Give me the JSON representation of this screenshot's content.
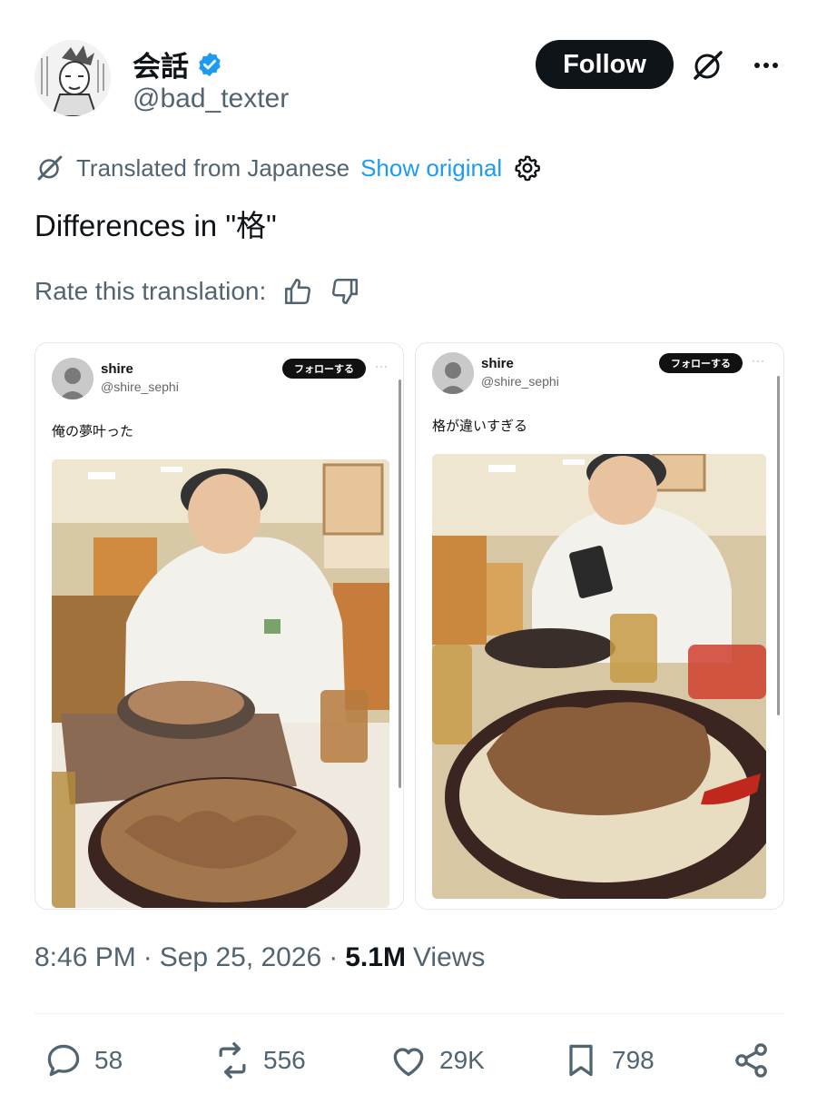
{
  "author": {
    "display_name": "会話",
    "handle": "@bad_texter",
    "verified": true,
    "follow_label": "Follow"
  },
  "translation": {
    "notice": "Translated from Japanese",
    "show_original": "Show original",
    "rate_label": "Rate this translation:"
  },
  "tweet": {
    "text": "Differences in \"格\""
  },
  "media": [
    {
      "name": "shire",
      "handle": "@shire_sephi",
      "follow_label": "フォローする",
      "text": "俺の夢叶った"
    },
    {
      "name": "shire",
      "handle": "@shire_sephi",
      "follow_label": "フォローする",
      "text": "格が違いすぎる"
    }
  ],
  "meta": {
    "time": "8:46 PM",
    "separator": "·",
    "date": "Sep 25, 2026",
    "views_count": "5.1M",
    "views_label": "Views"
  },
  "actions": {
    "replies": "58",
    "reposts": "556",
    "likes": "29K",
    "bookmarks": "798"
  },
  "colors": {
    "accent": "#1d9bf0",
    "text": "#0f1419",
    "secondary": "#536471"
  },
  "icons": [
    "grok-icon",
    "more-icon",
    "verified-badge-icon",
    "translate-icon",
    "settings-gear-icon",
    "thumbs-up-icon",
    "thumbs-down-icon",
    "reply-icon",
    "repost-icon",
    "like-icon",
    "bookmark-icon",
    "share-icon"
  ]
}
